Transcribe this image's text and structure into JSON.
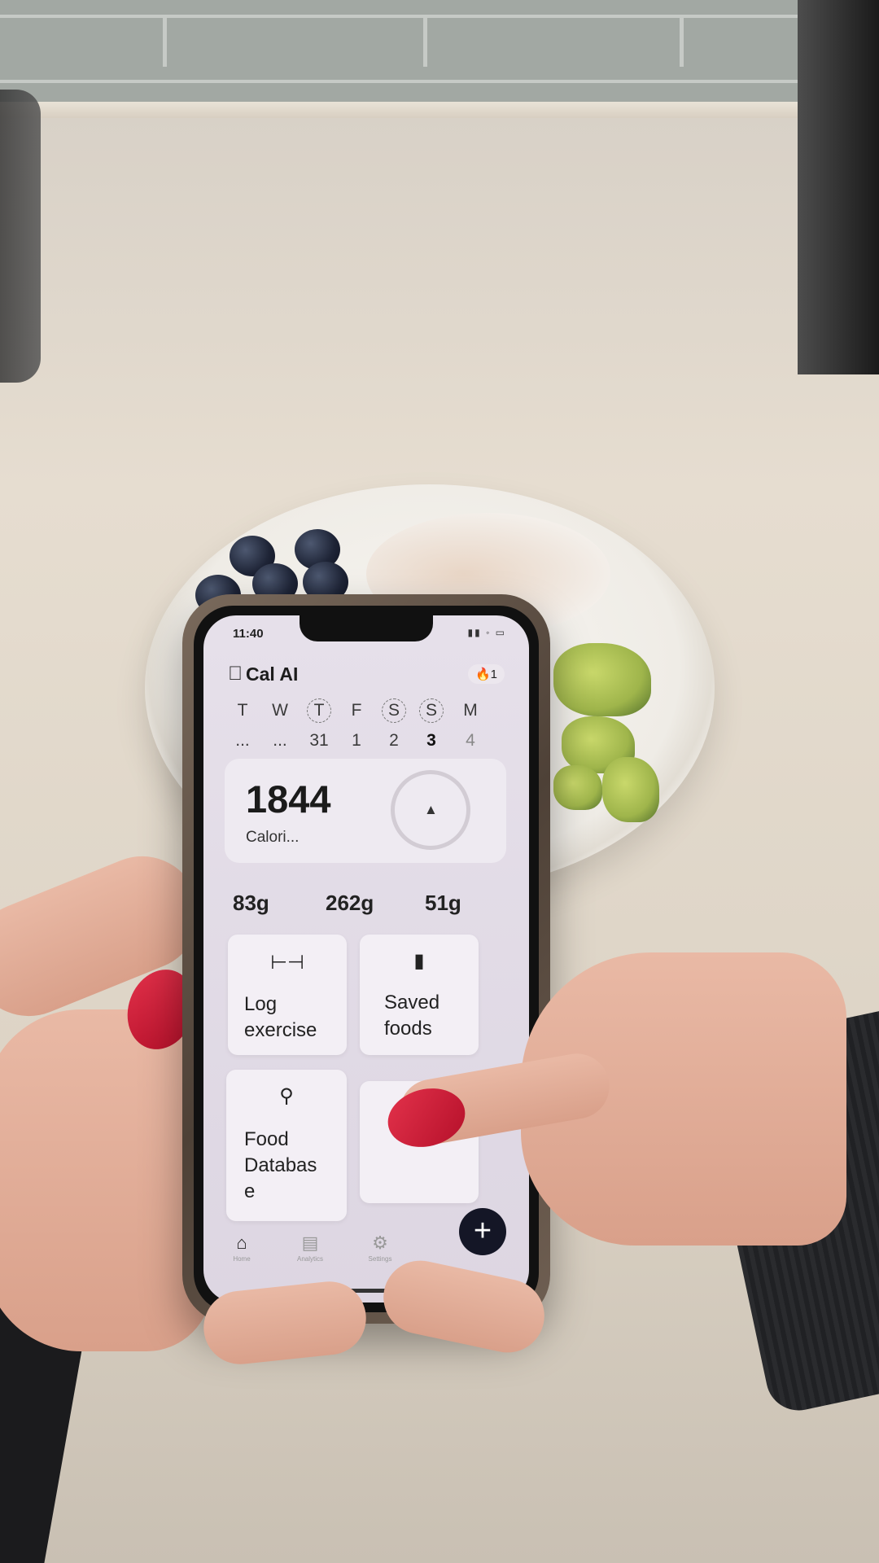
{
  "status_bar": {
    "time": "11:40",
    "icons": "▮▮ ◦ ▭"
  },
  "app": {
    "logo_icon": "apple-icon",
    "title": "Cal AI",
    "streak": "🔥1"
  },
  "week": [
    {
      "letter": "T",
      "num": "...",
      "ring": false,
      "state": "past"
    },
    {
      "letter": "W",
      "num": "...",
      "ring": false,
      "state": "past"
    },
    {
      "letter": "T",
      "num": "31",
      "ring": true,
      "state": "past"
    },
    {
      "letter": "F",
      "num": "1",
      "ring": false,
      "state": "past"
    },
    {
      "letter": "S",
      "num": "2",
      "ring": true,
      "state": "past"
    },
    {
      "letter": "S",
      "num": "3",
      "ring": true,
      "state": "active"
    },
    {
      "letter": "M",
      "num": "4",
      "ring": false,
      "state": "future"
    }
  ],
  "calories": {
    "value": "1844",
    "label": "Calori...",
    "icon": "flame-icon"
  },
  "macros": [
    "83g",
    "262g",
    "51g"
  ],
  "quick_actions": {
    "log_exercise": {
      "icon": "dumbbell-icon",
      "label_1": "Log",
      "label_2": "exercise"
    },
    "saved_foods": {
      "icon": "bookmark-icon",
      "label_1": "Saved",
      "label_2": "foods"
    },
    "food_database": {
      "icon": "search-icon",
      "label_1": "Food",
      "label_2": "Databas",
      "label_3": "e"
    },
    "scan_food": {
      "icon": "scan-icon"
    }
  },
  "tabs": [
    {
      "icon": "home-icon",
      "label": "Home",
      "active": true
    },
    {
      "icon": "bar-chart-icon",
      "label": "Analytics",
      "active": false
    },
    {
      "icon": "gear-icon",
      "label": "Settings",
      "active": false
    }
  ],
  "add_button": "+"
}
